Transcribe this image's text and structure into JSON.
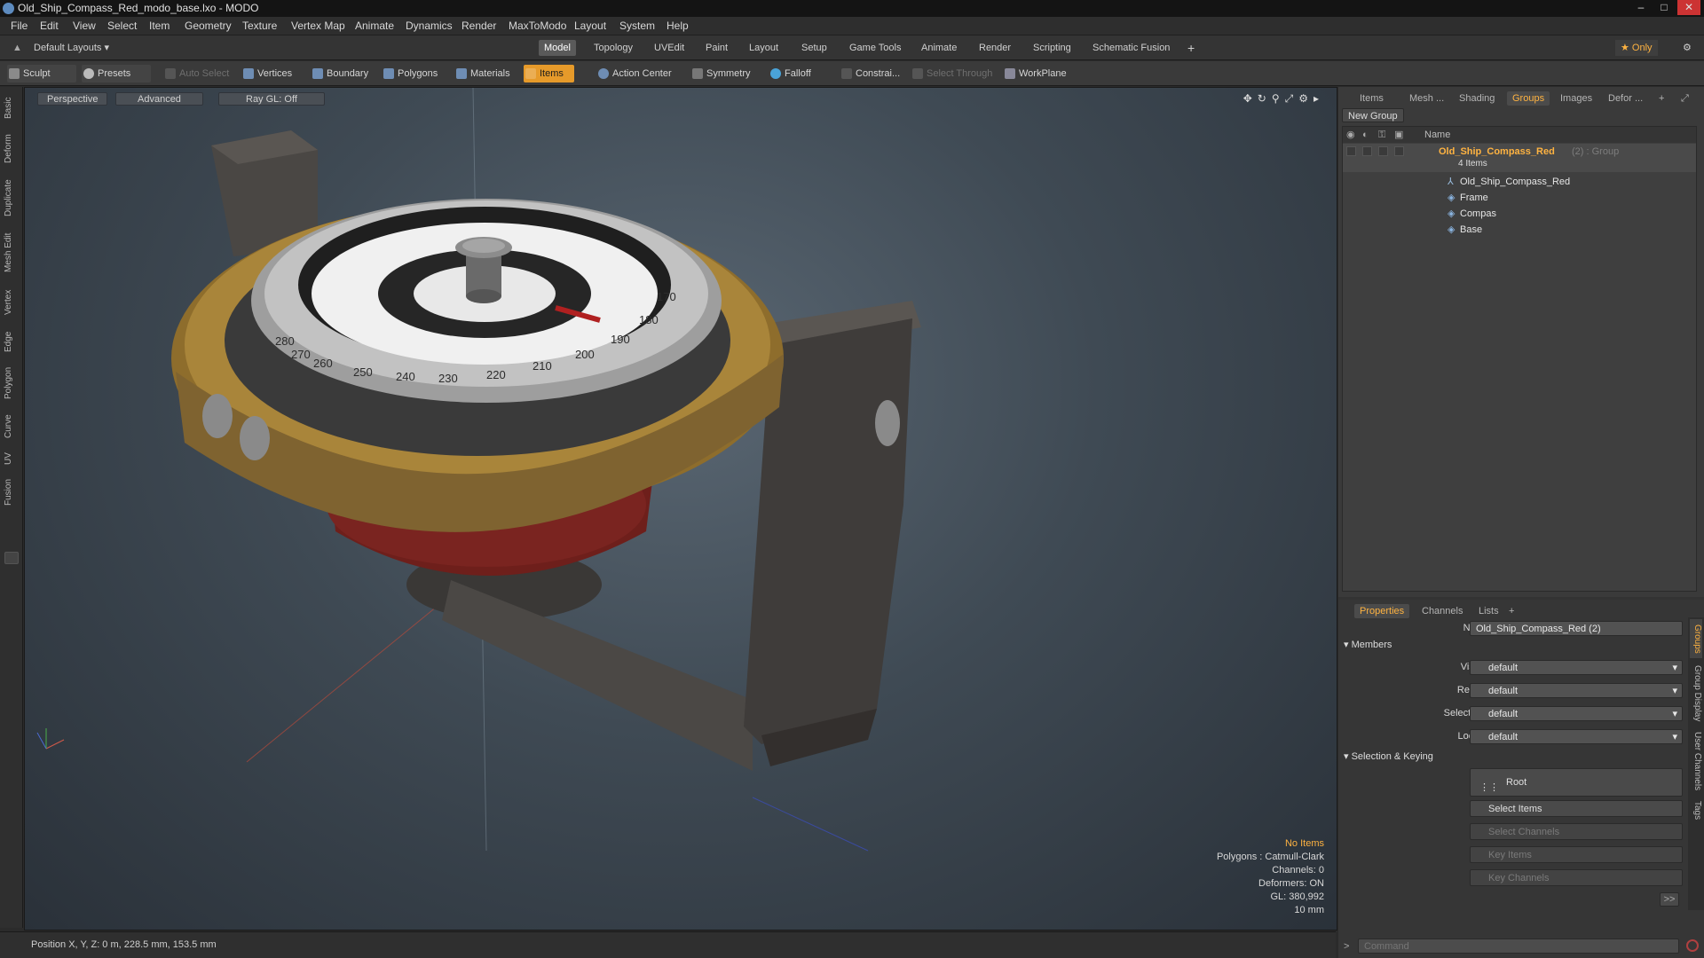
{
  "window": {
    "title": "Old_Ship_Compass_Red_modo_base.lxo - MODO",
    "min": "–",
    "max": "□",
    "close": "✕"
  },
  "menu": [
    "File",
    "Edit",
    "View",
    "Select",
    "Item",
    "Geometry",
    "Texture",
    "Vertex Map",
    "Animate",
    "Dynamics",
    "Render",
    "MaxToModo",
    "Layout",
    "System",
    "Help"
  ],
  "layoutbar": {
    "layouts_label": "Default Layouts ▾",
    "tabs": [
      "Model",
      "Topology",
      "UVEdit",
      "Paint",
      "Layout",
      "Setup",
      "Game Tools",
      "Animate",
      "Render",
      "Scripting",
      "Schematic Fusion"
    ],
    "active_tab": "Model",
    "add": "+",
    "only": "★ Only",
    "gear": "⚙"
  },
  "toolbar": {
    "sculpt": "Sculpt",
    "presets": "Presets",
    "auto_select": "Auto Select",
    "vertices": "Vertices",
    "boundary": "Boundary",
    "polygons": "Polygons",
    "materials": "Materials",
    "items": "Items",
    "action_center": "Action Center",
    "symmetry": "Symmetry",
    "falloff": "Falloff",
    "constraints": "Constrai...",
    "select_through": "Select Through",
    "workplane": "WorkPlane"
  },
  "lefttabs": [
    "Basic",
    "Deform",
    "Duplicate",
    "Mesh Edit",
    "Vertex",
    "Edge",
    "Polygon",
    "Curve",
    "UV",
    "Fusion"
  ],
  "viewport": {
    "perspective": "Perspective",
    "advanced": "Advanced",
    "raygl": "Ray GL: Off",
    "info": {
      "no_items": "No Items",
      "polygons": "Polygons : Catmull-Clark",
      "channels": "Channels: 0",
      "deformers": "Deformers: ON",
      "gl": "GL: 380,992",
      "scale": "10 mm"
    },
    "compass_ticks": [
      "260",
      "250",
      "240",
      "230",
      "220",
      "210",
      "200",
      "190",
      "180",
      "170",
      "280",
      "270"
    ]
  },
  "status": {
    "position": "Position X, Y, Z:   0 m, 228.5 mm, 153.5 mm"
  },
  "outliner": {
    "tabs": [
      "Items",
      "Mesh ...",
      "Shading",
      "Groups",
      "Images",
      "Defor ..."
    ],
    "active_tab": "Groups",
    "new_group": "New Group",
    "col_name": "Name",
    "group_name": "Old_Ship_Compass_Red",
    "group_suffix": "(2) : Group",
    "group_count": "4 Items",
    "children": [
      "Old_Ship_Compass_Red",
      "Frame",
      "Compas",
      "Base"
    ]
  },
  "props": {
    "tabs": [
      "Properties",
      "Channels",
      "Lists"
    ],
    "name_label": "Name",
    "name_value": "Old_Ship_Compass_Red (2)",
    "members": "Members",
    "rows": [
      {
        "label": "Visible",
        "value": "default"
      },
      {
        "label": "Render",
        "value": "default"
      },
      {
        "label": "Selectable",
        "value": "default"
      },
      {
        "label": "Locked",
        "value": "default"
      }
    ],
    "selection_keying": "Selection & Keying",
    "root": "Root",
    "select_items": "Select Items",
    "select_channels": "Select Channels",
    "key_items": "Key Items",
    "key_channels": "Key Channels",
    "more": ">>",
    "side_tabs": [
      "Groups",
      "Group Display",
      "User Channels",
      "Tags"
    ]
  },
  "command": {
    "placeholder": "Command",
    "prompt": ">"
  },
  "colors": {
    "accent": "#e69a2a",
    "orange_text": "#ffb341"
  }
}
